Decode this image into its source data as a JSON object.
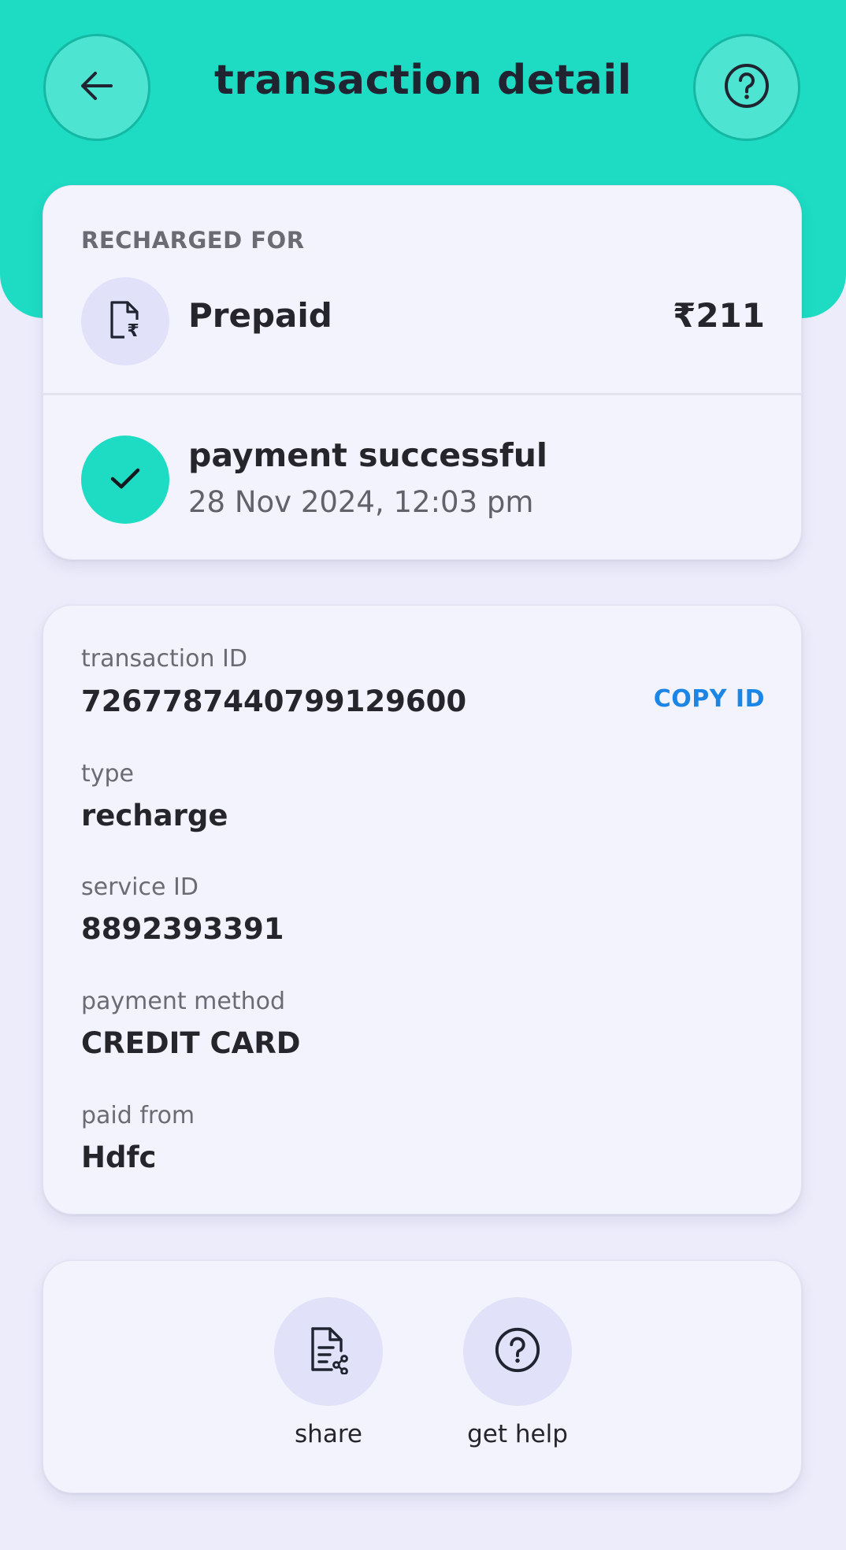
{
  "header": {
    "title": "transaction detail",
    "back_icon": "arrow-left-icon",
    "help_icon": "question-circle-icon"
  },
  "summary": {
    "section_label": "RECHARGED FOR",
    "service_name": "Prepaid",
    "service_icon": "rupee-document-icon",
    "amount": "₹211",
    "status": "payment successful",
    "status_icon": "checkmark-icon",
    "timestamp": "28 Nov 2024, 12:03 pm"
  },
  "details": {
    "transaction_id_label": "transaction ID",
    "transaction_id": "7267787440799129600",
    "copy_label": "COPY ID",
    "type_label": "type",
    "type": "recharge",
    "service_id_label": "service ID",
    "service_id": "8892393391",
    "payment_method_label": "payment method",
    "payment_method": "CREDIT CARD",
    "paid_from_label": "paid from",
    "paid_from": "Hdfc"
  },
  "actions": {
    "share_label": "share",
    "share_icon": "share-document-icon",
    "help_label": "get help",
    "help_icon": "question-circle-icon"
  },
  "colors": {
    "accent": "#1ddcc3",
    "background": "#ececfb",
    "card": "#f3f3fd",
    "link": "#1b86e6",
    "icon_bg": "#e1e1fa"
  }
}
